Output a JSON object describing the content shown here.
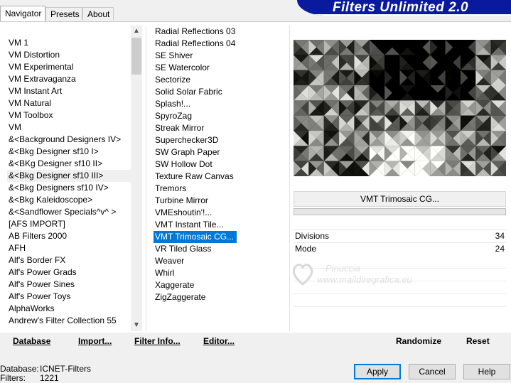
{
  "tabs": [
    "Navigator",
    "Presets",
    "About"
  ],
  "app_title": "Filters Unlimited 2.0",
  "categories": [
    "VM 1",
    "VM Distortion",
    "VM Experimental",
    "VM Extravaganza",
    "VM Instant Art",
    "VM Natural",
    "VM Toolbox",
    "VM",
    "&<Background Designers IV>",
    "&<Bkg Designer sf10 I>",
    "&<BKg Designer sf10 II>",
    "&<Bkg Designer sf10 III>",
    "&<Bkg Designers sf10 IV>",
    "&<Bkg Kaleidoscope>",
    "&<Sandflower Specials^v^ >",
    "[AFS IMPORT]",
    "AB Filters 2000",
    "AFH",
    "Alf's Border FX",
    "Alf's Power Grads",
    "Alf's Power Sines",
    "Alf's Power Toys",
    "AlphaWorks",
    "Andrew's Filter Collection 55"
  ],
  "selected_category": "&<Bkg Designer sf10 III>",
  "filters": [
    "Radial Reflections 03",
    "Radial Reflections 04",
    "SE Shiver",
    "SE Watercolor",
    "Sectorize",
    "Solid Solar Fabric",
    "Splash!...",
    "SpyroZag",
    "Streak Mirror",
    "Superchecker3D",
    "SW Graph Paper",
    "SW Hollow Dot",
    "Texture Raw Canvas",
    "Tremors",
    "Turbine Mirror",
    "VMEshoutin'!...",
    "VMT Instant Tile...",
    "VMT Trimosaic CG...",
    "VR Tiled Glass",
    "Weaver",
    "Whirl",
    "Xaggerate",
    "ZigZaggerate"
  ],
  "selected_filter": "VMT Trimosaic CG...",
  "current_filter_name": "VMT Trimosaic CG...",
  "params": [
    {
      "label": "Divisions",
      "value": "34"
    },
    {
      "label": "Mode",
      "value": "24"
    }
  ],
  "watermark": {
    "line1": "Pinuccia",
    "line2": "www.maildiregrafica.eu"
  },
  "toolbar": {
    "database": "Database",
    "import": "Import...",
    "filter_info": "Filter Info...",
    "editor": "Editor...",
    "randomize": "Randomize",
    "reset": "Reset"
  },
  "status": {
    "database_label": "Database:",
    "database_value": "ICNET-Filters",
    "filters_label": "Filters:",
    "filters_value": "1221"
  },
  "buttons": {
    "apply": "Apply",
    "cancel": "Cancel",
    "help": "Help"
  },
  "colors": {
    "accent": "#0078d7",
    "brand_bg": "#0a1a9e"
  }
}
